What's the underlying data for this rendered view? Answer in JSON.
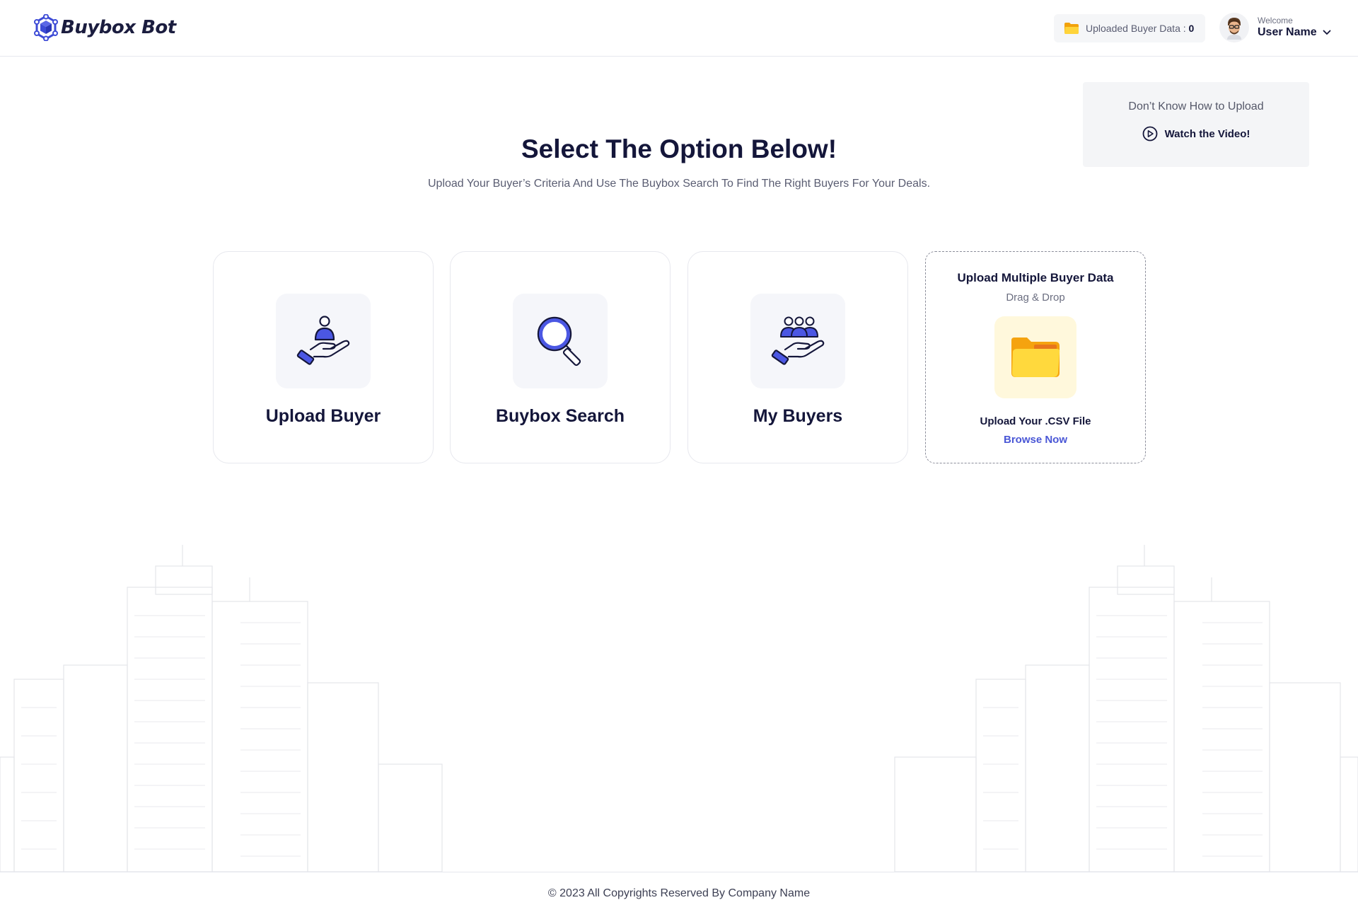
{
  "brand": {
    "name": "Buybox Bot",
    "accent": "#4a57d6"
  },
  "header": {
    "uploaded_label": "Uploaded Buyer Data : ",
    "uploaded_count": "0",
    "welcome": "Welcome",
    "user_name": "User Name"
  },
  "help": {
    "question": "Don’t Know How to Upload",
    "link_label": "Watch the Video!"
  },
  "main": {
    "title": "Select The Option Below!",
    "subtitle": "Upload Your Buyer’s Criteria And Use The Buybox Search To Find The Right Buyers For Your Deals."
  },
  "cards": [
    {
      "label": "Upload Buyer",
      "icon": "hand-user-icon"
    },
    {
      "label": "Buybox Search",
      "icon": "magnifier-icon"
    },
    {
      "label": "My Buyers",
      "icon": "hand-users-icon"
    }
  ],
  "dropzone": {
    "title": "Upload Multiple Buyer Data",
    "subtitle": "Drag & Drop",
    "file_label": "Upload Your .CSV File",
    "browse_label": "Browse Now"
  },
  "footer": {
    "copyright": "© 2023 All Copyrights Reserved By Company Name"
  }
}
